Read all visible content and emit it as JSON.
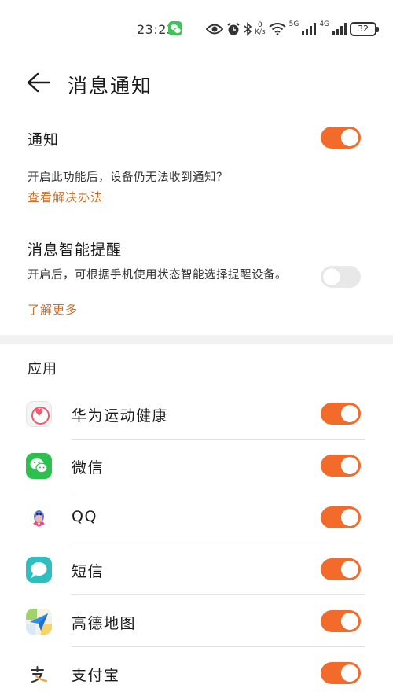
{
  "status_bar": {
    "time": "23:23",
    "speed_value": "0",
    "speed_unit": "K/s",
    "net1": "5G",
    "net2": "4G",
    "battery": "32"
  },
  "header": {
    "title": "消息通知"
  },
  "notification": {
    "title": "通知",
    "enabled": true,
    "hint": "开启此功能后，设备仍无法收到通知？",
    "link": "查看解决办法"
  },
  "smart_reminder": {
    "title": "消息智能提醒",
    "enabled": false,
    "description": "开启后，可根据手机使用状态智能选择提醒设备。",
    "link": "了解更多"
  },
  "apps_section": {
    "title": "应用",
    "items": [
      {
        "name": "华为运动健康",
        "icon": "huawei-health-icon",
        "enabled": true
      },
      {
        "name": "微信",
        "icon": "wechat-icon",
        "enabled": true
      },
      {
        "name": "QQ",
        "icon": "qq-icon",
        "enabled": true
      },
      {
        "name": "短信",
        "icon": "sms-icon",
        "enabled": true
      },
      {
        "name": "高德地图",
        "icon": "amap-icon",
        "enabled": true
      },
      {
        "name": "支付宝",
        "icon": "alipay-icon",
        "enabled": true
      }
    ]
  },
  "colors": {
    "accent": "#f26b2a",
    "link": "#c8702e",
    "toggle_off": "#e8e8e8"
  }
}
